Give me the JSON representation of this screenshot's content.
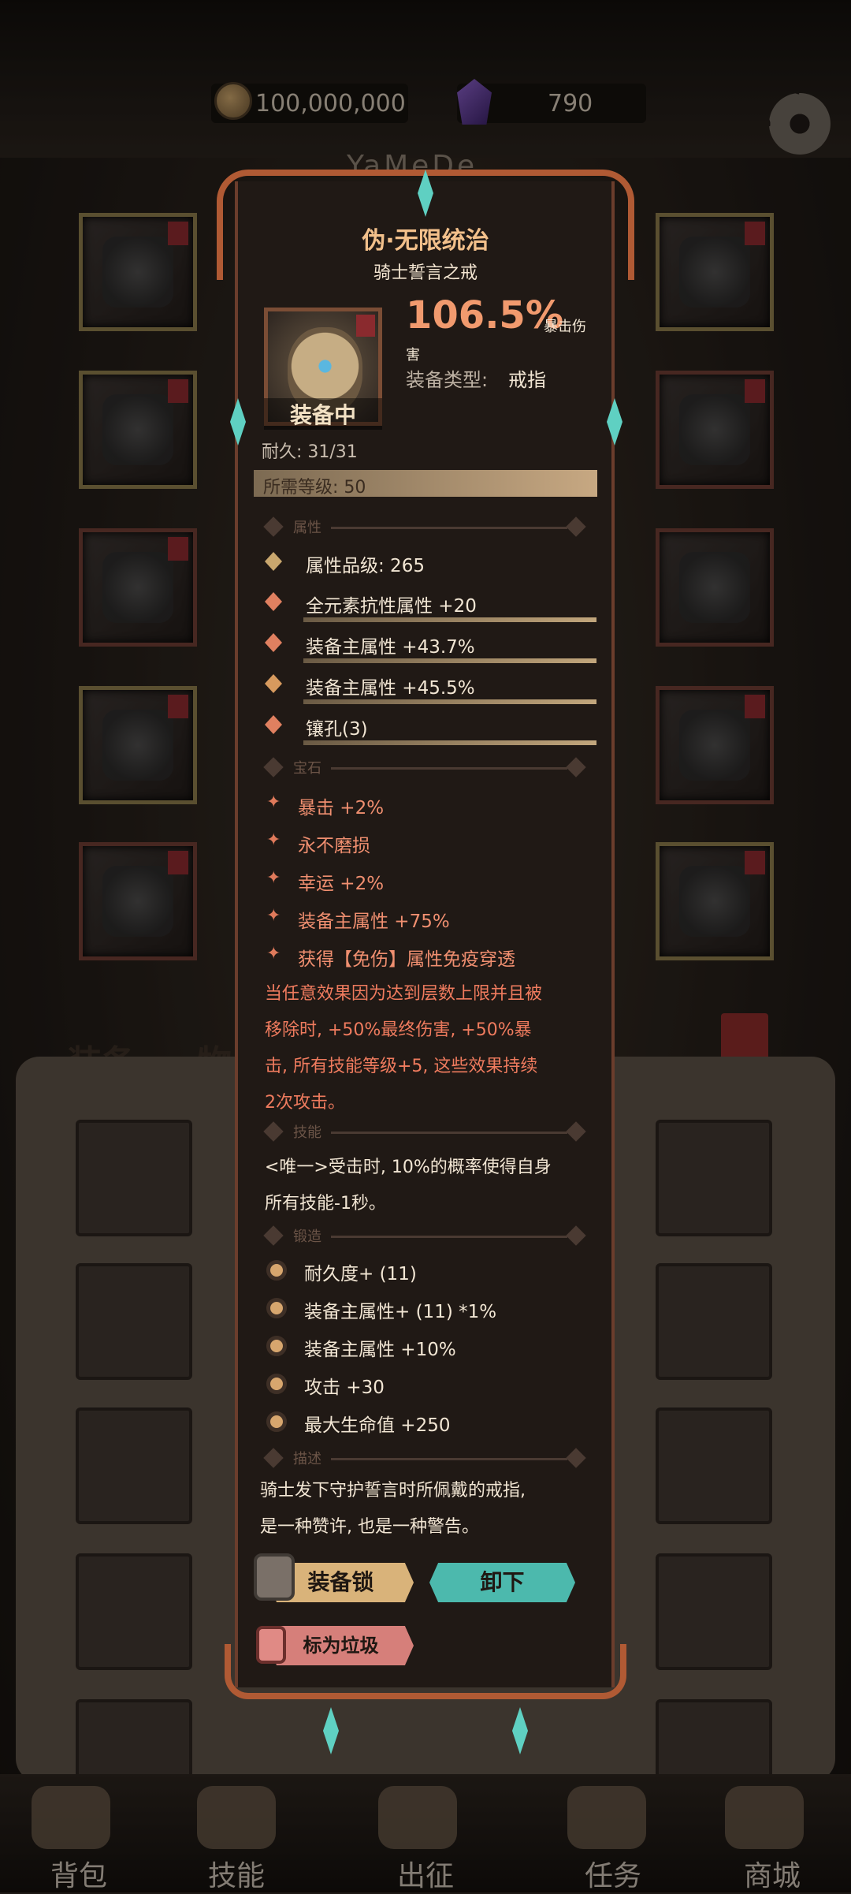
{
  "header": {
    "gold": "100,000,000",
    "gems": "790",
    "player_name": "YaMeDe"
  },
  "tabs": {
    "equipment": "装备",
    "items": "物品"
  },
  "nav": {
    "bag": "背包",
    "skills": "技能",
    "battle": "出征",
    "tasks": "任务",
    "shop": "商城"
  },
  "item": {
    "name": "伪·无限统治",
    "subtitle": "骑士誓言之戒",
    "equipped_label": "装备中",
    "crit_value": "106.5%",
    "crit_label_1": "暴击伤",
    "crit_label_2": "害",
    "type_label": "装备类型:",
    "type_value": "戒指",
    "durability": "耐久: 31/31",
    "required_level": "所需等级: 50"
  },
  "sections": {
    "attributes": "属性",
    "gems": "宝石",
    "skills": "技能",
    "forging": "锻造",
    "description": "描述"
  },
  "attributes": [
    "属性品级: 265",
    "全元素抗性属性 +20",
    "装备主属性 +43.7%",
    "装备主属性 +45.5%",
    "镶孔(3)"
  ],
  "gems": [
    "暴击 +2%",
    "永不磨损",
    "幸运 +2%",
    "装备主属性 +75%",
    "获得【免伤】属性免疫穿透"
  ],
  "gem_effect": "当任意效果因为达到层数上限并且被\n移除时, +50%最终伤害, +50%暴\n击, 所有技能等级+5, 这些效果持续\n2次攻击。",
  "skill_text": "<唯一>受击时, 10%的概率使得自身\n所有技能-1秒。",
  "forging": [
    "耐久度+ (11)",
    "装备主属性+ (11) *1%",
    "装备主属性 +10%",
    "攻击 +30",
    "最大生命值 +250"
  ],
  "description": "骑士发下守护誓言时所佩戴的戒指,\n是一种赞许, 也是一种警告。",
  "buttons": {
    "lock": "装备锁",
    "unload": "卸下",
    "mark_junk": "标为垃圾"
  }
}
